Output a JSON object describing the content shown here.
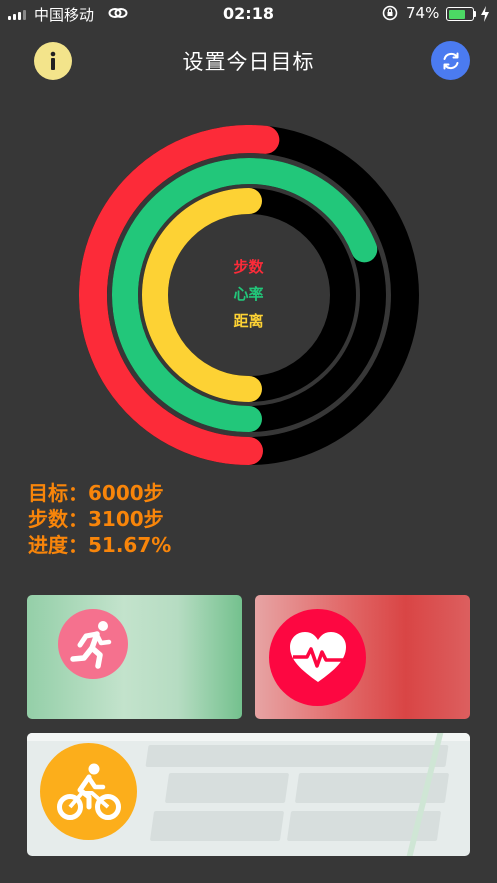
{
  "status_bar": {
    "carrier": "中国移动",
    "time": "02:18",
    "battery_percent": "74%",
    "battery_level": 0.74,
    "battery_color": "#4cd964"
  },
  "header": {
    "title": "设置今日目标",
    "info_icon": "info-icon",
    "refresh_icon": "refresh-icon"
  },
  "rings": {
    "labels": {
      "steps": "步数",
      "heart_rate": "心率",
      "distance": "距离"
    },
    "colors": {
      "steps": "#fc2b39",
      "heart_rate": "#22c77a",
      "distance": "#fdd234",
      "track": "#000000"
    },
    "progress": {
      "steps": 0.5167,
      "heart_rate": 0.69,
      "distance": 0.5
    }
  },
  "stats": {
    "goal": "目标：6000步",
    "steps": "步数：3100步",
    "progress": "进度：51.67%"
  },
  "cards": [
    {
      "name": "running",
      "icon": "running-icon",
      "color": "#f5718e"
    },
    {
      "name": "heart-rate",
      "icon": "heart-rate-icon",
      "color": "#fd0741"
    },
    {
      "name": "cycling",
      "icon": "cycling-icon",
      "color": "#fcae1b"
    }
  ]
}
